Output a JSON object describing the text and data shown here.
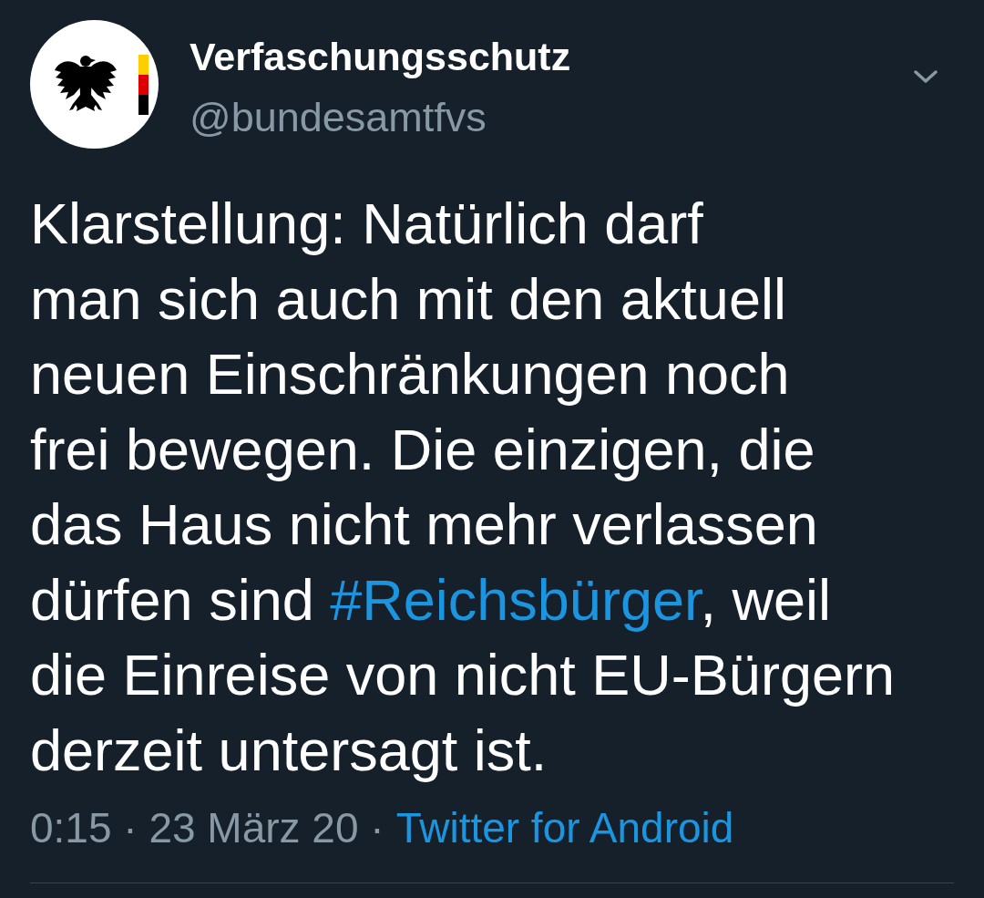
{
  "tweet": {
    "author": {
      "name": "Verfaschungsschutz",
      "handle": "@bundesamtfvs"
    },
    "body": [
      {
        "kind": "text",
        "text": "Klarstellung: Natürlich darf\nman sich auch mit den aktuell\nneuen Einschränkungen noch\nfrei bewegen. Die einzigen, die\ndas Haus nicht mehr verlassen\ndürfen sind "
      },
      {
        "kind": "hashtag",
        "text": "#Reichsbürger"
      },
      {
        "kind": "text",
        "text": ", weil\ndie Einreise von nicht EU-Bürgern\nderzeit untersagt ist."
      }
    ],
    "meta": {
      "timestamp": "0:15 · 23 März 20 ·",
      "source": "Twitter for Android"
    }
  }
}
